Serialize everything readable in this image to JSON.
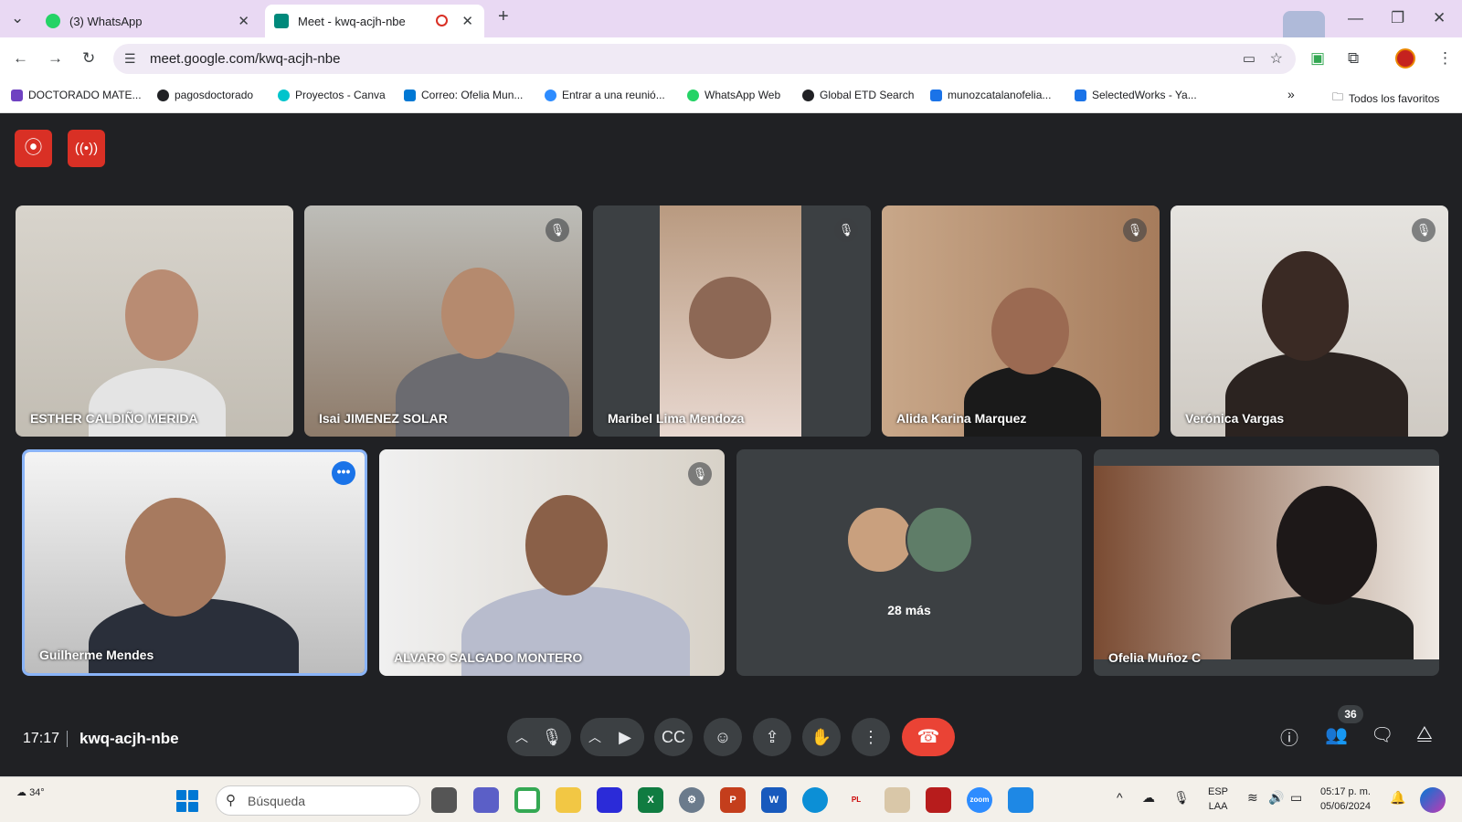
{
  "browser": {
    "tabs": [
      {
        "label": "(3) WhatsApp",
        "icon": "whatsapp-icon"
      },
      {
        "label": "Meet - kwq-acjh-nbe",
        "icon": "meet-icon",
        "recording_indicator": true
      }
    ],
    "url": "meet.google.com/kwq-acjh-nbe",
    "bookmarks": [
      "DOCTORADO MATE...",
      "pagosdoctorado",
      "Proyectos - Canva",
      "Correo: Ofelia Mun...",
      "Entrar a una reunió...",
      "WhatsApp Web",
      "Global ETD Search",
      "munozcatalanofelia...",
      "SelectedWorks - Ya..."
    ],
    "all_bookmarks": "Todos los favoritos"
  },
  "meet": {
    "participants": [
      {
        "name": "ESTHER CALDIÑO MERIDA",
        "muted": false
      },
      {
        "name": "Isai JIMENEZ SOLAR",
        "muted": true
      },
      {
        "name": "Maribel Lima Mendoza",
        "muted": true
      },
      {
        "name": "Alida Karina Marquez",
        "muted": true
      },
      {
        "name": "Verónica Vargas",
        "muted": true
      },
      {
        "name": "Guilherme Mendes",
        "muted": false
      },
      {
        "name": "ALVARO SALGADO MONTERO",
        "muted": true
      },
      {
        "name": "Ofelia Muñoz C",
        "muted": false
      }
    ],
    "more_label": "28 más",
    "time": "17:17",
    "meeting_code": "kwq-acjh-nbe",
    "participant_count": "36"
  },
  "taskbar": {
    "weather": "34°",
    "search_placeholder": "Búsqueda",
    "lang_line1": "ESP",
    "lang_line2": "LAA",
    "time": "05:17 p. m.",
    "date": "05/06/2024"
  },
  "colors": {
    "tab_strip": "#e9d9f3",
    "meet_bg": "#202124",
    "hangup": "#ea4335",
    "record": "#d93025",
    "active_speaker": "#8ab4f8"
  }
}
